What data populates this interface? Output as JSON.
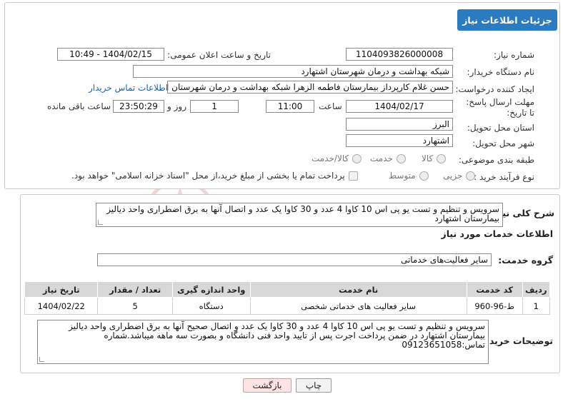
{
  "header": {
    "title": "جزئیات اطلاعات نیاز"
  },
  "fields": {
    "need_number_label": "شماره نیاز:",
    "need_number": "1104093826000008",
    "announce_label": "تاریخ و ساعت اعلان عمومی:",
    "announce_value": "1404/02/15 - 10:49",
    "buyer_org_label": "نام دستگاه خریدار:",
    "buyer_org": "شبکه بهداشت و درمان شهرستان اشتهارد",
    "creator_label": "ایجاد کننده درخواست:",
    "creator": "حسن غلام کارپرداز بیمارستان فاطمه الزهرا شبکه بهداشت و درمان شهرستان اشتهارد",
    "contact_link": "اطلاعات تماس خریدار",
    "deadline_label": "مهلت ارسال پاسخ: تا تاریخ:",
    "deadline_date": "1404/02/17",
    "time_label": "ساعت",
    "deadline_time": "11:00",
    "days_value": "1",
    "days_label": "روز و",
    "remaining_time": "23:50:29",
    "remaining_label": "ساعت باقی مانده",
    "province_label": "استان محل تحویل:",
    "province": "البرز",
    "city_label": "شهر محل تحویل:",
    "city": "اشتهارد",
    "category_label": "طبقه بندی موضوعی:",
    "category_options": [
      "کالا",
      "خدمت",
      "کالا/خدمت"
    ],
    "process_label": "نوع فرآیند خرید :",
    "process_options": [
      "جزیی",
      "متوسط"
    ],
    "payment_note": "پرداخت تمام یا بخشی از مبلغ خرید،از محل \"اسناد خزانه اسلامی\" خواهد بود."
  },
  "summary": {
    "label": "شرح کلی نیاز:",
    "text": "سرویس و تنظیم و تست یو پی اس 10 کاوا 4 عدد و 30 کاوا یک عدد و اتصال آنها به برق اضطراری واحد دیالیز بیمارستان اشتهارد"
  },
  "services": {
    "section_title": "اطلاعات خدمات مورد نیاز",
    "group_label": "گروه خدمت:",
    "group_value": "سایر فعالیت‌های خدماتی",
    "columns": [
      "ردیف",
      "کد خدمت",
      "نام خدمت",
      "واحد اندازه گیری",
      "تعداد / مقدار",
      "تاریخ نیاز"
    ],
    "rows": [
      [
        "1",
        "ط-96-960",
        "سایر فعالیت های خدماتی شخصی",
        "دستگاه",
        "5",
        "1404/02/22"
      ]
    ]
  },
  "buyer_notes": {
    "label": "توضیحات خریدار:",
    "text": "سرویس و تنظیم و تست یو پی اس 10 کاوا 4 عدد و 30 کاوا یک عدد و اتصال صحیح آنها به برق اضطراری واحد دیالیز بیمارستان اشتهارد در ضمن پرداخت اجرت پس از تایید واحد فنی دانشگاه و بصورت سه ماهه میباشد.شماره تماس:09123651058"
  },
  "buttons": {
    "print": "چاپ",
    "back": "بازگشت"
  },
  "colors": {
    "header": "#2a7bbf",
    "link": "#1f62a8",
    "back_button": "#fde3e3"
  }
}
